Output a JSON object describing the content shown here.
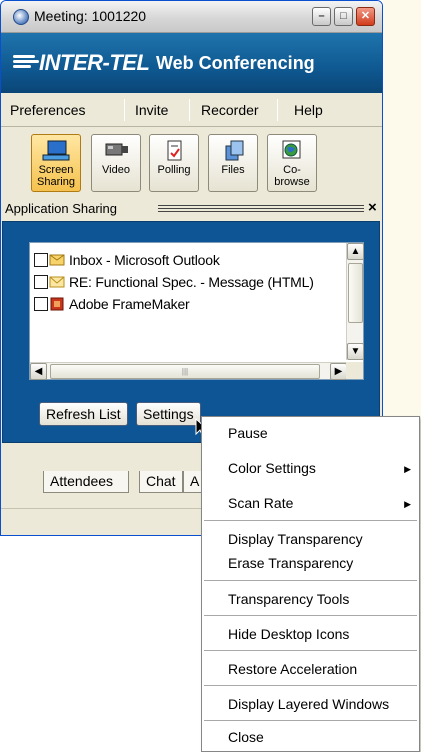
{
  "window": {
    "title": "Meeting: 1001220"
  },
  "banner": {
    "brand": "INTER-TEL",
    "product": "Web Conferencing"
  },
  "menubar": {
    "items": [
      "Preferences",
      "Invite",
      "Recorder",
      "Help"
    ]
  },
  "toolbar": {
    "buttons": [
      {
        "label": "Screen Sharing",
        "icon": "monitor-icon",
        "active": true
      },
      {
        "label": "Video",
        "icon": "video-camera-icon"
      },
      {
        "label": "Polling",
        "icon": "poll-sheet-icon"
      },
      {
        "label": "Files",
        "icon": "files-icon"
      },
      {
        "label": "Co-browse",
        "icon": "globe-icon"
      }
    ]
  },
  "panel": {
    "title": "Application Sharing",
    "close": "×",
    "list": [
      {
        "label": "Inbox - Microsoft Outlook",
        "icon": "outlook-envelope-icon",
        "checked": false
      },
      {
        "label": "RE: Functional Spec. - Message (HTML)",
        "icon": "mail-message-icon",
        "checked": false
      },
      {
        "label": "Adobe FrameMaker",
        "icon": "framemaker-icon",
        "checked": false
      }
    ],
    "refresh_label": "Refresh List",
    "settings_label": "Settings"
  },
  "tabs": [
    "Attendees",
    "Chat",
    "A"
  ],
  "context_menu": {
    "items": [
      {
        "label": "Pause"
      },
      {
        "label": "Color Settings",
        "submenu": true
      },
      {
        "label": "Scan Rate",
        "submenu": true
      },
      {
        "label": "Display Transparency"
      },
      {
        "label": "Erase Transparency"
      },
      {
        "label": "Transparency Tools"
      },
      {
        "label": "Hide Desktop Icons"
      },
      {
        "label": "Restore Acceleration"
      },
      {
        "label": "Display Layered Windows"
      },
      {
        "label": "Close"
      }
    ],
    "submenu_arrow": "▶"
  },
  "colors": {
    "banner": "#0f5891",
    "panel": "#0d5594",
    "active_tool": "#f5c24e"
  }
}
